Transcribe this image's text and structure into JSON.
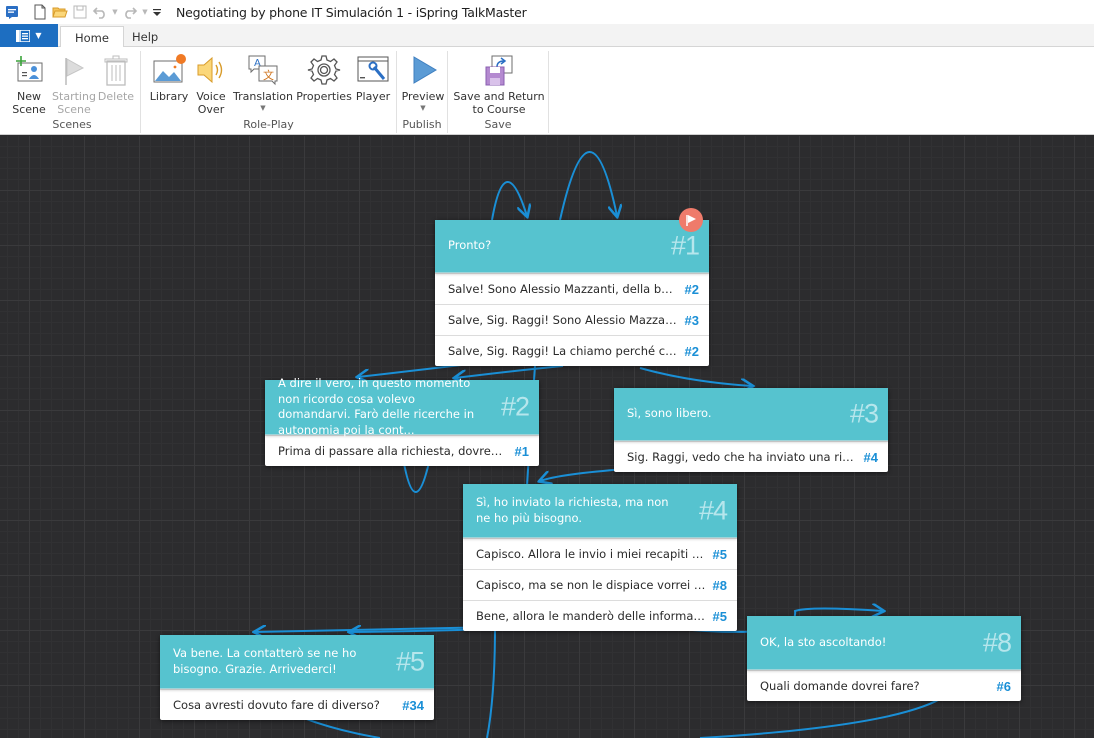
{
  "window": {
    "title": "Negotiating by phone IT Simulación 1 - iSpring TalkMaster",
    "quick_access": [
      "app-icon",
      "new-file-icon",
      "open-folder-icon",
      "save-icon",
      "undo-icon",
      "redo-icon",
      "customize-icon"
    ]
  },
  "tabs": [
    {
      "label": "Home",
      "active": true
    },
    {
      "label": "Help",
      "active": false
    }
  ],
  "ribbon": {
    "groups": [
      {
        "label": "Scenes",
        "buttons": [
          {
            "label_line1": "New",
            "label_line2": "Scene",
            "icon": "new-scene-icon",
            "enabled": true
          },
          {
            "label_line1": "Starting",
            "label_line2": "Scene",
            "icon": "flag-icon",
            "enabled": false
          },
          {
            "label_line1": "Delete",
            "label_line2": "",
            "icon": "trash-icon",
            "enabled": false
          }
        ]
      },
      {
        "label": "Role-Play",
        "buttons": [
          {
            "label_line1": "Library",
            "label_line2": "",
            "icon": "library-icon",
            "enabled": true
          },
          {
            "label_line1": "Voice",
            "label_line2": "Over",
            "icon": "speaker-icon",
            "enabled": true
          },
          {
            "label_line1": "Translation",
            "label_line2": "",
            "icon": "translation-icon",
            "enabled": true,
            "dropdown": true
          },
          {
            "label_line1": "Properties",
            "label_line2": "",
            "icon": "gear-icon",
            "enabled": true
          },
          {
            "label_line1": "Player",
            "label_line2": "",
            "icon": "player-icon",
            "enabled": true
          }
        ]
      },
      {
        "label": "Publish",
        "buttons": [
          {
            "label_line1": "Preview",
            "label_line2": "",
            "icon": "play-icon",
            "enabled": true,
            "dropdown": true
          }
        ]
      },
      {
        "label": "Save",
        "buttons": [
          {
            "label_line1": "Save and Return",
            "label_line2": "to Course",
            "icon": "save-return-icon",
            "enabled": true
          }
        ]
      }
    ]
  },
  "colors": {
    "card_header": "#56c3cf",
    "link": "#1a8fd6",
    "start_flag": "#ef7b6b",
    "canvas": "#2c2c2e",
    "file_button": "#1d6ec1"
  },
  "scenes": [
    {
      "id": "#1",
      "text": "Pronto?",
      "is_start": true,
      "options": [
        {
          "text": "Salve! Sono Alessio Mazzanti, della banc...",
          "target": "#2"
        },
        {
          "text": "Salve, Sig. Raggi! Sono Alessio Mazzanti...",
          "target": "#3"
        },
        {
          "text": "Salve, Sig. Raggi! La chiamo perché ci h...",
          "target": "#2"
        }
      ]
    },
    {
      "id": "#2",
      "text": "A dire il vero, in questo momento non ricordo cosa volevo domandarvi. Farò delle ricerche in autonomia poi la cont...",
      "options": [
        {
          "text": "Prima di passare alla richiesta, dovresti c...",
          "target": "#1"
        }
      ]
    },
    {
      "id": "#3",
      "text": "Sì, sono libero.",
      "options": [
        {
          "text": "Sig. Raggi, vedo che ha inviato una rich...",
          "target": "#4"
        }
      ]
    },
    {
      "id": "#4",
      "text": "Sì, ho inviato la richiesta, ma non ne ho più bisogno.",
      "options": [
        {
          "text": "Capisco. Allora le invio i miei recapiti pe...",
          "target": "#5"
        },
        {
          "text": "Capisco, ma se non le dispiace vorrei fa...",
          "target": "#8"
        },
        {
          "text": "Bene, allora le manderò delle informazi...",
          "target": "#5"
        }
      ]
    },
    {
      "id": "#5",
      "text": "Va bene. La contatterò se ne ho bisogno. Grazie. Arrivederci!",
      "options": [
        {
          "text": "Cosa avresti dovuto fare di diverso?",
          "target": "#34"
        }
      ]
    },
    {
      "id": "#8",
      "text": "OK, la sto ascoltando!",
      "options": [
        {
          "text": "Quali domande dovrei fare?",
          "target": "#6"
        }
      ]
    }
  ]
}
